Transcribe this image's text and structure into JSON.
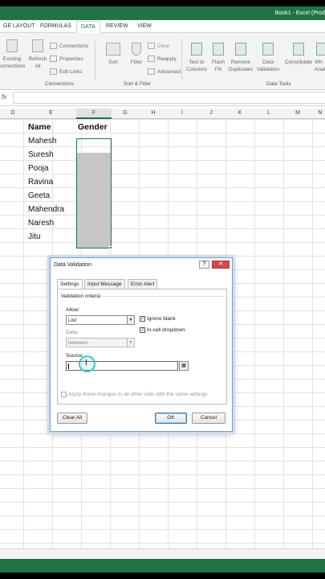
{
  "window": {
    "title": "Book1 - Excel (Prod"
  },
  "tabs": [
    "GE LAYOUT",
    "FORMULAS",
    "DATA",
    "REVIEW",
    "VIEW"
  ],
  "ribbon": {
    "existing_connections": [
      "Existing",
      "onnections"
    ],
    "refresh_all": [
      "Refresh",
      "All"
    ],
    "connections_items": [
      "Connections",
      "Properties",
      "Edit Links"
    ],
    "group_connections": "Connections",
    "sort": "Sort",
    "filter": "Filter",
    "filter_items": [
      "Clear",
      "Reapply",
      "Advanced"
    ],
    "group_sort_filter": "Sort & Filter",
    "text_to_columns": [
      "Text to",
      "Columns"
    ],
    "flash_fill": [
      "Flash",
      "Fill"
    ],
    "remove_duplicates": [
      "Remove",
      "Duplicates"
    ],
    "data_validation": [
      "Data",
      "Validation"
    ],
    "consolidate": "Consolidate",
    "whatif": [
      "Wh",
      "Anal"
    ],
    "group_data_tools": "Data Tools"
  },
  "formula_bar": {
    "fx": "fx",
    "value": ""
  },
  "columns": [
    "D",
    "E",
    "F",
    "G",
    "H",
    "I",
    "J",
    "K",
    "L",
    "M",
    "N"
  ],
  "sheet": {
    "header_name": "Name",
    "header_gender": "Gender",
    "names": [
      "Mahesh",
      "Suresh",
      "Pooja",
      "Ravina",
      "Geeta",
      "Mahendra",
      "Naresh",
      "Jitu"
    ]
  },
  "dialog": {
    "title": "Data Validation",
    "help": "?",
    "close": "✕",
    "tabs": [
      "Settings",
      "Input Message",
      "Error Alert"
    ],
    "group_title": "Validation criteria",
    "allow_label": "Allow:",
    "allow_value": "List",
    "data_label": "Data:",
    "data_value": "between",
    "ignore_blank": "Ignore blank",
    "in_cell_dropdown": "In-cell dropdown",
    "source_label": "Source:",
    "source_value": "",
    "apply_all": "Apply these changes to all other cells with the same settings",
    "clear_all": "Clear All",
    "ok": "OK",
    "cancel": "Cancel"
  }
}
